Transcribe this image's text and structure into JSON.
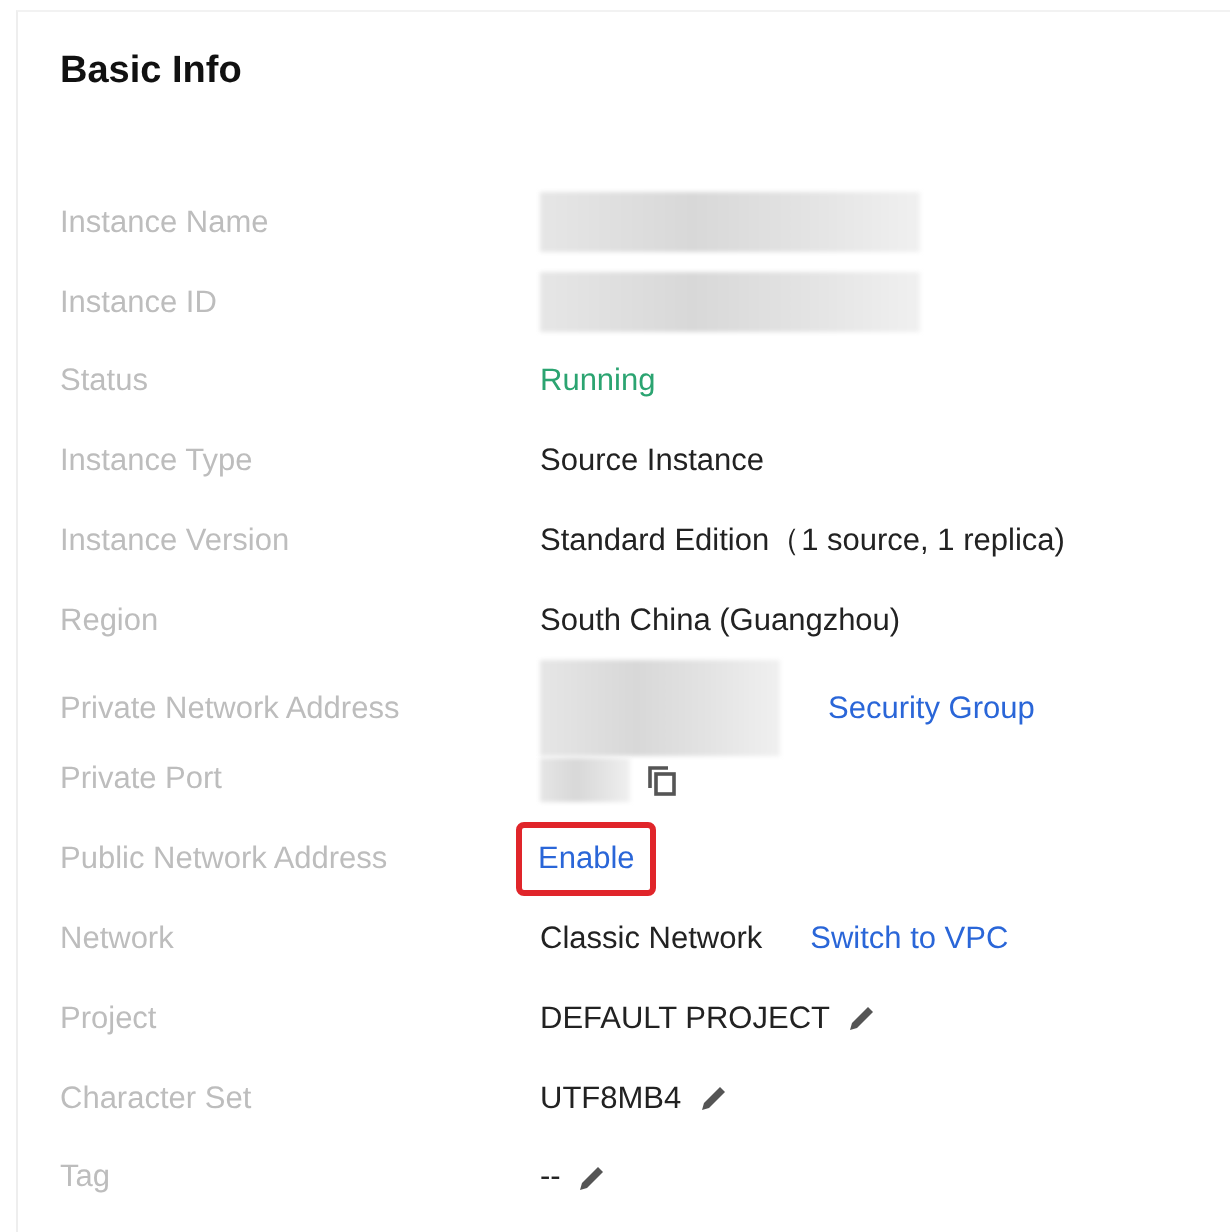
{
  "card": {
    "title": "Basic Info",
    "rows": [
      {
        "label": "Instance Name",
        "parts": [
          {
            "kind": "redacted"
          }
        ]
      },
      {
        "label": "Instance ID",
        "parts": [
          {
            "kind": "redacted"
          }
        ]
      },
      {
        "label": "Status",
        "parts": [
          {
            "kind": "status",
            "text": "Running"
          }
        ]
      },
      {
        "label": "Instance Type",
        "parts": [
          {
            "kind": "text",
            "text": "Source Instance"
          }
        ]
      },
      {
        "label": "Instance Version",
        "parts": [
          {
            "kind": "text",
            "text": "Standard Edition（1 source, 1 replica)"
          }
        ]
      },
      {
        "label": "Region",
        "parts": [
          {
            "kind": "text",
            "text": "South China (Guangzhou)"
          }
        ]
      },
      {
        "label": "Private Network Address",
        "parts": [
          {
            "kind": "redacted"
          },
          {
            "kind": "link",
            "text": "Security Group",
            "highlighted": false
          }
        ]
      },
      {
        "label": "Private Port",
        "parts": [
          {
            "kind": "redacted"
          },
          {
            "kind": "copy_icon"
          }
        ]
      },
      {
        "label": "Public Network Address",
        "parts": [
          {
            "kind": "link",
            "text": "Enable",
            "highlighted": true
          }
        ]
      },
      {
        "label": "Network",
        "parts": [
          {
            "kind": "text",
            "text": "Classic Network"
          },
          {
            "kind": "link",
            "text": "Switch to VPC",
            "highlighted": false
          }
        ]
      },
      {
        "label": "Project",
        "parts": [
          {
            "kind": "text",
            "text": "DEFAULT PROJECT"
          },
          {
            "kind": "edit_icon"
          }
        ]
      },
      {
        "label": "Character Set",
        "parts": [
          {
            "kind": "text",
            "text": "UTF8MB4"
          },
          {
            "kind": "edit_icon"
          }
        ]
      },
      {
        "label": "Tag",
        "parts": [
          {
            "kind": "text",
            "text": "--"
          },
          {
            "kind": "edit_icon"
          }
        ]
      }
    ]
  }
}
